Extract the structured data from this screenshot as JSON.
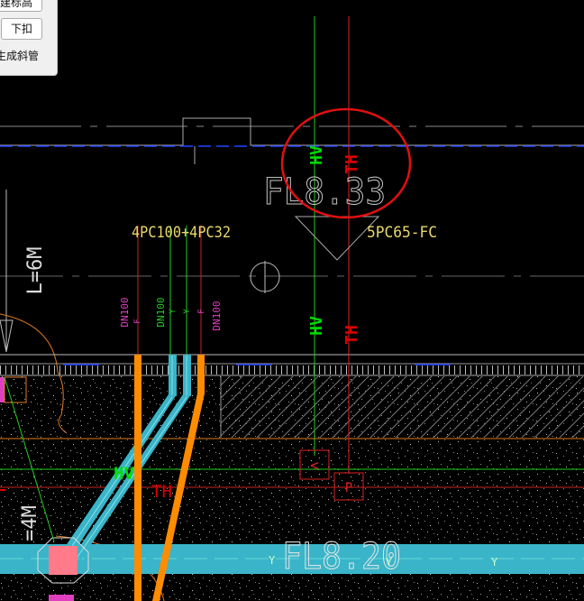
{
  "panel": {
    "partial_button_label": "建标高",
    "down_button_label": "下扣",
    "checkbox_label": "生成斜管"
  },
  "drawing": {
    "level_top": "FL8.33",
    "level_bottom": "FL8.20",
    "pipe_group_left": "4PC100+4PC32",
    "pipe_group_right": "5PC65-FC",
    "length_upper": "L=6M",
    "length_lower": "=4M",
    "pipe_tags": [
      "DN100",
      "DN100",
      "DN100"
    ],
    "pipe_subtags": [
      "F",
      "Y",
      "Y",
      "F"
    ],
    "system_hv": "HV",
    "system_th": "TH",
    "riser_hv_tag": "HV",
    "riser_th_tag": "TH",
    "symbol_hv_box": "<",
    "symbol_th_box": "P",
    "line_mark_y": "Y",
    "colors": {
      "background": "#000000",
      "hv_green": "#00dd00",
      "th_red": "#dd0000",
      "pipe_cyan": "#3ab4c8",
      "pipe_orange": "#ff8c00",
      "annotation_yellow": "#e8d86a",
      "tag_magenta": "#e040c0",
      "highlight_circle": "#e01010",
      "fill_pink": "#ff7b8a"
    }
  }
}
